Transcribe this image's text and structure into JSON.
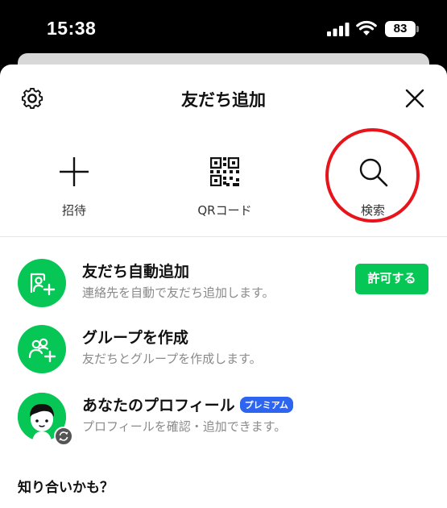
{
  "status_bar": {
    "time": "15:38",
    "battery": "83"
  },
  "header": {
    "title": "友だち追加"
  },
  "actions": [
    {
      "label": "招待",
      "icon": "plus-icon"
    },
    {
      "label": "QRコード",
      "icon": "qr-code-icon"
    },
    {
      "label": "検索",
      "icon": "search-icon"
    }
  ],
  "rows": {
    "auto_add": {
      "title": "友だち自動追加",
      "subtitle": "連絡先を自動で友だち追加します。",
      "button": "許可する"
    },
    "group": {
      "title": "グループを作成",
      "subtitle": "友だちとグループを作成します。"
    },
    "profile": {
      "title": "あなたのプロフィール",
      "badge": "プレミアム",
      "subtitle": "プロフィールを確認・追加できます。"
    }
  },
  "section": {
    "maybe_known": "知り合いかも？"
  },
  "colors": {
    "line_green": "#06c755",
    "highlight_red": "#e8141c",
    "premium_blue": "#2d64f0"
  }
}
